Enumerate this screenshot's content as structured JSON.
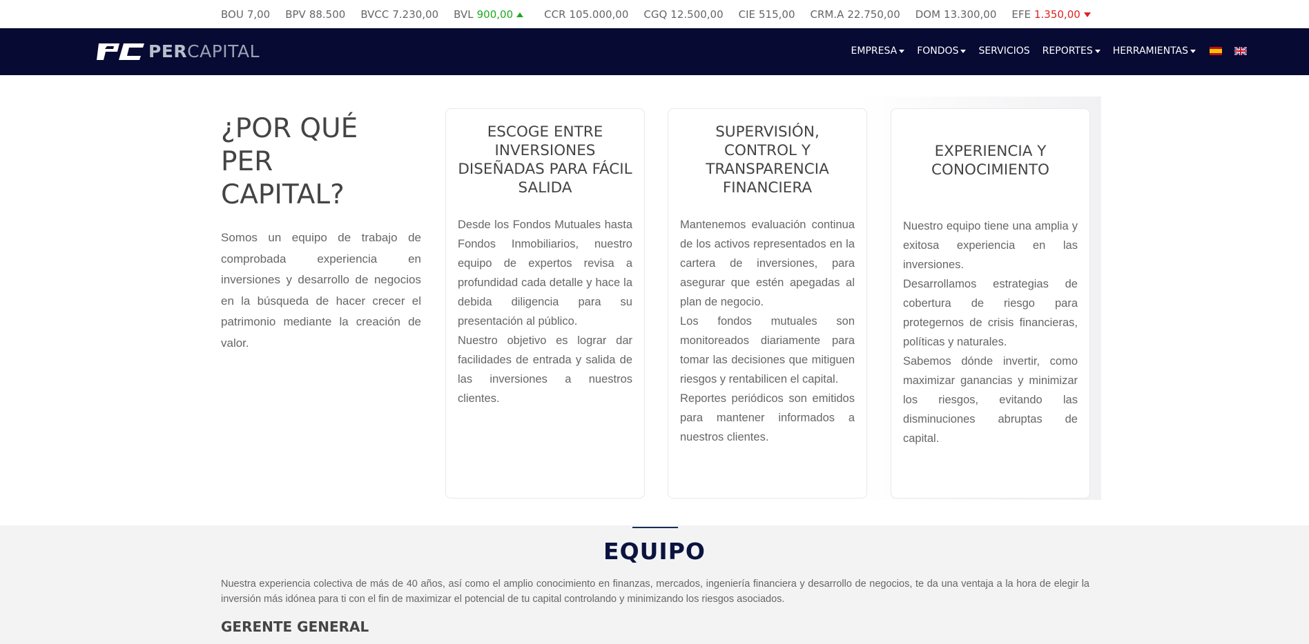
{
  "ticker": [
    {
      "symbol": "BOU",
      "value": "7,00",
      "trend": "neutral"
    },
    {
      "symbol": "BPV",
      "value": "88.500",
      "trend": "neutral"
    },
    {
      "symbol": "BVCC",
      "value": "7.230,00",
      "trend": "neutral"
    },
    {
      "symbol": "BVL",
      "value": "900,00",
      "trend": "up"
    },
    {
      "symbol": "CCR",
      "value": "105.000,00",
      "trend": "neutral"
    },
    {
      "symbol": "CGQ",
      "value": "12.500,00",
      "trend": "neutral"
    },
    {
      "symbol": "CIE",
      "value": "515,00",
      "trend": "neutral"
    },
    {
      "symbol": "CRM.A",
      "value": "22.750,00",
      "trend": "neutral"
    },
    {
      "symbol": "DOM",
      "value": "13.300,00",
      "trend": "neutral"
    },
    {
      "symbol": "EFE",
      "value": "1.350,00",
      "trend": "down"
    }
  ],
  "colors": {
    "navbar": "#070a33",
    "up": "#1fa81f",
    "down": "#e02020"
  },
  "brand": {
    "name_bold": "PER",
    "name_rest": "CAPITAL"
  },
  "nav": {
    "items": [
      {
        "label": "EMPRESA",
        "dropdown": true
      },
      {
        "label": "FONDOS",
        "dropdown": true
      },
      {
        "label": "SERVICIOS",
        "dropdown": false
      },
      {
        "label": "REPORTES",
        "dropdown": true
      },
      {
        "label": "HERRAMIENTAS",
        "dropdown": true
      }
    ],
    "languages": [
      "es-flag-icon",
      "uk-flag-icon"
    ]
  },
  "why": {
    "title": "¿POR QUÉ PER CAPITAL?",
    "text": "Somos un equipo de trabajo de comprobada experiencia en inversiones y desarrollo de negocios en la búsqueda de hacer crecer el patrimonio mediante la creación de valor."
  },
  "cards": [
    {
      "title": "ESCOGE ENTRE INVERSIONES DISEÑADAS PARA FÁCIL SALIDA",
      "paragraphs": [
        "Desde los Fondos Mutuales hasta Fondos Inmobiliarios, nuestro equipo de expertos revisa a profundidad cada detalle y hace la debida diligencia para su presentación al público.",
        "Nuestro objetivo es lograr dar facilidades de entrada y salida de las inversiones a nuestros clientes."
      ]
    },
    {
      "title": "SUPERVISIÓN, CONTROL Y TRANSPARENCIA FINANCIERA",
      "paragraphs": [
        "Mantenemos evaluación continua de los activos representados en la cartera de inversiones, para asegurar que estén apegadas al plan de negocio.",
        "Los fondos mutuales son monitoreados diariamente para tomar las decisiones que mitiguen riesgos y rentabilicen el capital.",
        "Reportes periódicos son emitidos para mantener informados a nuestros clientes."
      ]
    },
    {
      "title": "EXPERIENCIA Y CONOCIMIENTO",
      "paragraphs": [
        "Nuestro equipo tiene una amplia y exitosa experiencia en las inversiones.",
        "Desarrollamos estrategias de cobertura de riesgo para protegernos de crisis financieras, políticas y naturales.",
        "Sabemos dónde invertir, como maximizar ganancias y minimizar los riesgos, evitando las disminuciones abruptas de capital."
      ]
    }
  ],
  "equipo": {
    "title": "EQUIPO",
    "text": "Nuestra experiencia colectiva de más de 40 años, así como el amplio conocimiento en finanzas, mercados, ingeniería financiera y desarrollo de negocios, te da una ventaja a la hora de elegir la inversión más idónea para ti con el fin de maximizar el potencial de tu capital controlando y minimizando los riesgos asociados.",
    "subtitle": "GERENTE GENERAL"
  }
}
